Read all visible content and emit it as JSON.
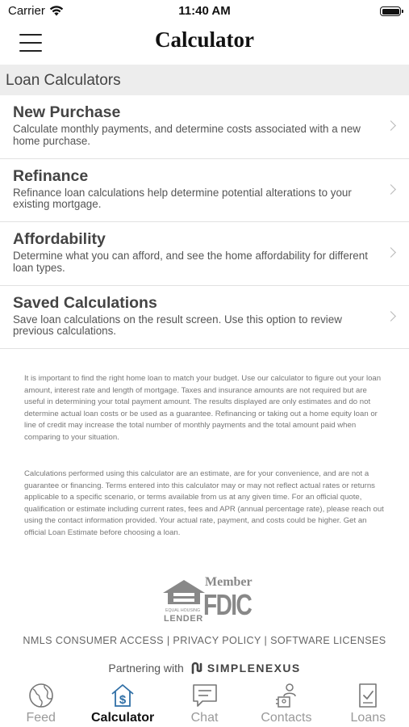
{
  "status_bar": {
    "carrier": "Carrier",
    "time": "11:40 AM"
  },
  "nav": {
    "title": "Calculator"
  },
  "section": {
    "header": "Loan Calculators"
  },
  "menu": {
    "items": [
      {
        "title": "New Purchase",
        "description": "Calculate monthly payments, and determine costs associated with a new home purchase."
      },
      {
        "title": "Refinance",
        "description": "Refinance loan calculations help determine potential alterations to your existing mortgage."
      },
      {
        "title": "Affordability",
        "description": "Determine what you can afford, and see the home affordability for different loan types."
      },
      {
        "title": "Saved Calculations",
        "description": "Save loan calculations on the result screen. Use this option to review previous calculations."
      }
    ]
  },
  "disclaimers": {
    "first": "It is important to find the right home loan to match your budget. Use our calculator to figure out your loan amount, interest rate and length of mortgage. Taxes and insurance amounts are not required but are useful in determining your total payment amount. The results displayed are only estimates and do not determine actual loan costs or be used as a guarantee. Refinancing or taking out a home equity loan or line of credit may increase the total number of monthly payments and the total amount paid when comparing to your situation.",
    "second": "Calculations performed using this calculator are an estimate, are for your convenience, and are not a guarantee or financing. Terms entered into this calculator may or may not reflect actual rates or returns applicable to a specific scenario, or terms available from us at any given time. For an official quote, qualification or estimate including current rates, fees and APR (annual percentage rate), please reach out using the contact information provided. Your actual rate, payment, and costs could be higher. Get an official Loan Estimate before choosing a loan."
  },
  "logos": {
    "eho_top": "EQUAL HOUSING",
    "eho_bottom": "LENDER",
    "fdic_member": "Member",
    "fdic": "FDIC"
  },
  "footer": {
    "nmls": "NMLS CONSUMER ACCESS",
    "separator": "|",
    "privacy": "PRIVACY POLICY",
    "licenses": "SOFTWARE LICENSES",
    "partnering": "Partnering with",
    "brand": "SIMPLENEXUS"
  },
  "tabs": [
    {
      "label": "Feed",
      "icon": "globe-icon",
      "active": false
    },
    {
      "label": "Calculator",
      "icon": "calculator-house-icon",
      "active": true
    },
    {
      "label": "Chat",
      "icon": "chat-icon",
      "active": false
    },
    {
      "label": "Contacts",
      "icon": "contacts-icon",
      "active": false
    },
    {
      "label": "Loans",
      "icon": "loan-document-icon",
      "active": false
    }
  ],
  "colors": {
    "section_header_bg": "#ededed",
    "active_tab_icon": "#2f6fa6",
    "inactive_tab": "#9a9a9a"
  }
}
